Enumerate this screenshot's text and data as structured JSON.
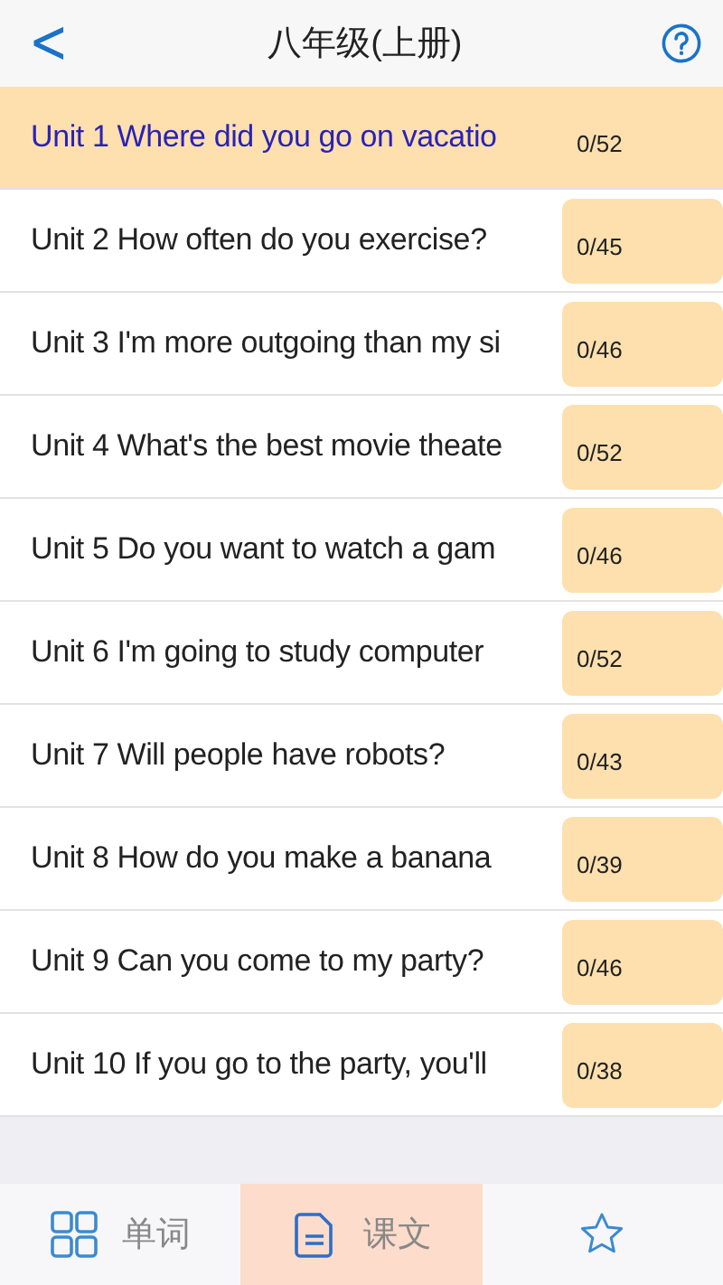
{
  "header": {
    "back": "<",
    "title": "八年级(上册)"
  },
  "units": [
    {
      "title": "Unit 1 Where did you go on vacatio",
      "count": "0/52",
      "selected": true
    },
    {
      "title": "Unit 2 How often do you exercise?",
      "count": "0/45",
      "selected": false
    },
    {
      "title": "Unit 3 I'm more outgoing than my si",
      "count": "0/46",
      "selected": false
    },
    {
      "title": "Unit 4 What's the best movie theate",
      "count": "0/52",
      "selected": false
    },
    {
      "title": "Unit 5 Do you want to watch a gam",
      "count": "0/46",
      "selected": false
    },
    {
      "title": "Unit 6 I'm going to study computer",
      "count": "0/52",
      "selected": false
    },
    {
      "title": "Unit 7 Will people have robots?",
      "count": "0/43",
      "selected": false
    },
    {
      "title": "Unit 8 How do you make a banana",
      "count": "0/39",
      "selected": false
    },
    {
      "title": "Unit 9 Can you come to my party?",
      "count": "0/46",
      "selected": false
    },
    {
      "title": "Unit 10 If you go to the party, you'll",
      "count": "0/38",
      "selected": false
    }
  ],
  "tabs": [
    {
      "kind": "grid",
      "label": "单词",
      "selected": false
    },
    {
      "kind": "document",
      "label": "课文",
      "selected": true
    },
    {
      "kind": "star",
      "selected": false
    }
  ]
}
